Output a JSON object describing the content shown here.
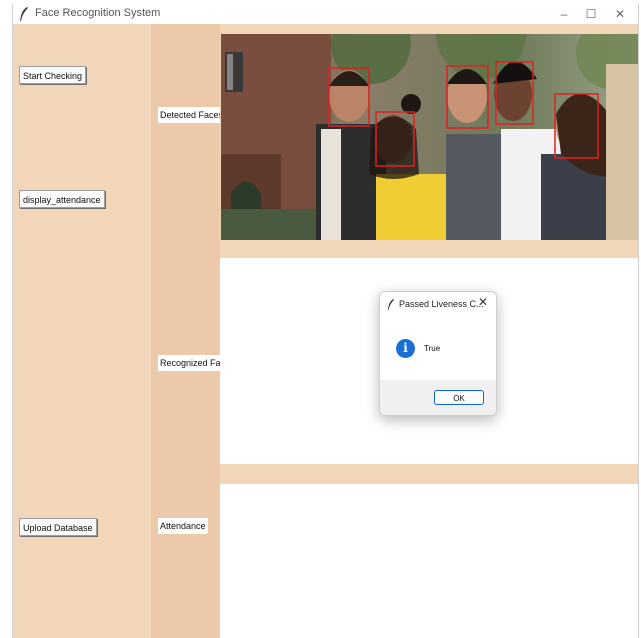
{
  "window": {
    "title": "Face Recognition System",
    "controls": {
      "minimize": "–",
      "maximize": "☐",
      "close": "✕"
    }
  },
  "left_panel": {
    "start_checking": "Start Checking",
    "display_attendance": "display_attendance",
    "upload_database": "Upload Database"
  },
  "labels": {
    "detected_faces": "Detected Faces",
    "recognized_faces": "Recognized Face",
    "attendance": "Attendance"
  },
  "dialog": {
    "title": "Passed Liveness C...",
    "message": "True",
    "ok": "OK",
    "close": "✕",
    "icon": "info-icon"
  },
  "colors": {
    "panel_light": "#f1d6ba",
    "panel_mid": "#ecc9a8",
    "face_box": "#e02020",
    "info_blue": "#1a6fd6"
  }
}
